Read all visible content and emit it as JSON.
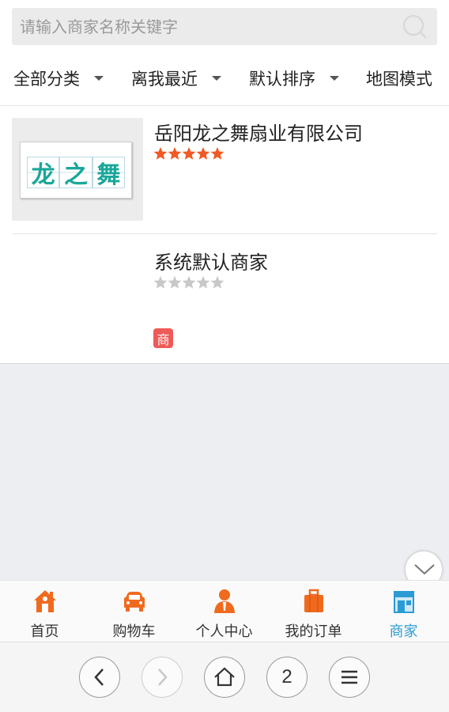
{
  "search": {
    "placeholder": "请输入商家名称关键字",
    "icon": "search-icon"
  },
  "filters": [
    {
      "label": "全部分类",
      "has_caret": true
    },
    {
      "label": "离我最近",
      "has_caret": true
    },
    {
      "label": "默认排序",
      "has_caret": true
    },
    {
      "label": "地图模式",
      "has_caret": false
    }
  ],
  "shops": [
    {
      "name": "岳阳龙之舞扇业有限公司",
      "rating": 5,
      "logo_text": [
        "龙",
        "之",
        "舞"
      ],
      "badge": null
    },
    {
      "name": "系统默认商家",
      "rating": 0,
      "logo_text": null,
      "badge": "商"
    }
  ],
  "tabbar": [
    {
      "label": "首页",
      "icon": "home-icon",
      "active": false
    },
    {
      "label": "购物车",
      "icon": "cart-icon",
      "active": false
    },
    {
      "label": "个人中心",
      "icon": "user-icon",
      "active": false
    },
    {
      "label": "我的订单",
      "icon": "orders-icon",
      "active": false
    },
    {
      "label": "商家",
      "icon": "shop-icon",
      "active": true
    }
  ],
  "browser": {
    "back_icon": "chevron-left-icon",
    "forward_icon": "chevron-right-icon",
    "home_icon": "home-outline-icon",
    "tab_count": "2",
    "menu_icon": "menu-icon"
  },
  "colors": {
    "star_active": "#f15a24",
    "star_inactive": "#c8c8c8",
    "active_tab": "#2a9bd4",
    "badge": "#ee5b57",
    "icon_orange": "#f06a1e"
  }
}
